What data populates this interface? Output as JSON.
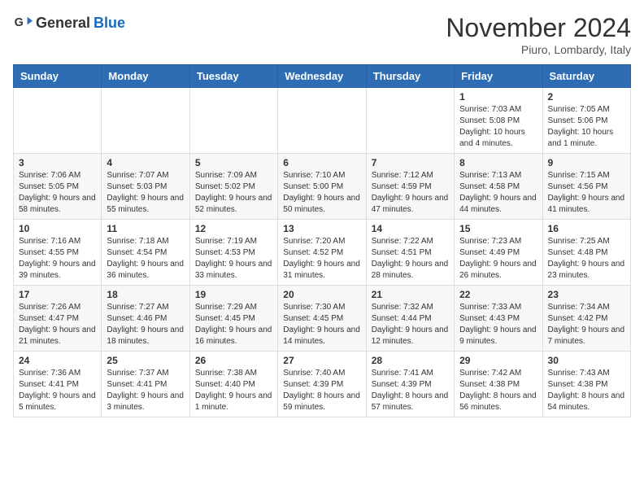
{
  "header": {
    "logo_general": "General",
    "logo_blue": "Blue",
    "month_title": "November 2024",
    "location": "Piuro, Lombardy, Italy"
  },
  "weekdays": [
    "Sunday",
    "Monday",
    "Tuesday",
    "Wednesday",
    "Thursday",
    "Friday",
    "Saturday"
  ],
  "weeks": [
    [
      {
        "day": "",
        "info": ""
      },
      {
        "day": "",
        "info": ""
      },
      {
        "day": "",
        "info": ""
      },
      {
        "day": "",
        "info": ""
      },
      {
        "day": "",
        "info": ""
      },
      {
        "day": "1",
        "info": "Sunrise: 7:03 AM\nSunset: 5:08 PM\nDaylight: 10 hours and 4 minutes."
      },
      {
        "day": "2",
        "info": "Sunrise: 7:05 AM\nSunset: 5:06 PM\nDaylight: 10 hours and 1 minute."
      }
    ],
    [
      {
        "day": "3",
        "info": "Sunrise: 7:06 AM\nSunset: 5:05 PM\nDaylight: 9 hours and 58 minutes."
      },
      {
        "day": "4",
        "info": "Sunrise: 7:07 AM\nSunset: 5:03 PM\nDaylight: 9 hours and 55 minutes."
      },
      {
        "day": "5",
        "info": "Sunrise: 7:09 AM\nSunset: 5:02 PM\nDaylight: 9 hours and 52 minutes."
      },
      {
        "day": "6",
        "info": "Sunrise: 7:10 AM\nSunset: 5:00 PM\nDaylight: 9 hours and 50 minutes."
      },
      {
        "day": "7",
        "info": "Sunrise: 7:12 AM\nSunset: 4:59 PM\nDaylight: 9 hours and 47 minutes."
      },
      {
        "day": "8",
        "info": "Sunrise: 7:13 AM\nSunset: 4:58 PM\nDaylight: 9 hours and 44 minutes."
      },
      {
        "day": "9",
        "info": "Sunrise: 7:15 AM\nSunset: 4:56 PM\nDaylight: 9 hours and 41 minutes."
      }
    ],
    [
      {
        "day": "10",
        "info": "Sunrise: 7:16 AM\nSunset: 4:55 PM\nDaylight: 9 hours and 39 minutes."
      },
      {
        "day": "11",
        "info": "Sunrise: 7:18 AM\nSunset: 4:54 PM\nDaylight: 9 hours and 36 minutes."
      },
      {
        "day": "12",
        "info": "Sunrise: 7:19 AM\nSunset: 4:53 PM\nDaylight: 9 hours and 33 minutes."
      },
      {
        "day": "13",
        "info": "Sunrise: 7:20 AM\nSunset: 4:52 PM\nDaylight: 9 hours and 31 minutes."
      },
      {
        "day": "14",
        "info": "Sunrise: 7:22 AM\nSunset: 4:51 PM\nDaylight: 9 hours and 28 minutes."
      },
      {
        "day": "15",
        "info": "Sunrise: 7:23 AM\nSunset: 4:49 PM\nDaylight: 9 hours and 26 minutes."
      },
      {
        "day": "16",
        "info": "Sunrise: 7:25 AM\nSunset: 4:48 PM\nDaylight: 9 hours and 23 minutes."
      }
    ],
    [
      {
        "day": "17",
        "info": "Sunrise: 7:26 AM\nSunset: 4:47 PM\nDaylight: 9 hours and 21 minutes."
      },
      {
        "day": "18",
        "info": "Sunrise: 7:27 AM\nSunset: 4:46 PM\nDaylight: 9 hours and 18 minutes."
      },
      {
        "day": "19",
        "info": "Sunrise: 7:29 AM\nSunset: 4:45 PM\nDaylight: 9 hours and 16 minutes."
      },
      {
        "day": "20",
        "info": "Sunrise: 7:30 AM\nSunset: 4:45 PM\nDaylight: 9 hours and 14 minutes."
      },
      {
        "day": "21",
        "info": "Sunrise: 7:32 AM\nSunset: 4:44 PM\nDaylight: 9 hours and 12 minutes."
      },
      {
        "day": "22",
        "info": "Sunrise: 7:33 AM\nSunset: 4:43 PM\nDaylight: 9 hours and 9 minutes."
      },
      {
        "day": "23",
        "info": "Sunrise: 7:34 AM\nSunset: 4:42 PM\nDaylight: 9 hours and 7 minutes."
      }
    ],
    [
      {
        "day": "24",
        "info": "Sunrise: 7:36 AM\nSunset: 4:41 PM\nDaylight: 9 hours and 5 minutes."
      },
      {
        "day": "25",
        "info": "Sunrise: 7:37 AM\nSunset: 4:41 PM\nDaylight: 9 hours and 3 minutes."
      },
      {
        "day": "26",
        "info": "Sunrise: 7:38 AM\nSunset: 4:40 PM\nDaylight: 9 hours and 1 minute."
      },
      {
        "day": "27",
        "info": "Sunrise: 7:40 AM\nSunset: 4:39 PM\nDaylight: 8 hours and 59 minutes."
      },
      {
        "day": "28",
        "info": "Sunrise: 7:41 AM\nSunset: 4:39 PM\nDaylight: 8 hours and 57 minutes."
      },
      {
        "day": "29",
        "info": "Sunrise: 7:42 AM\nSunset: 4:38 PM\nDaylight: 8 hours and 56 minutes."
      },
      {
        "day": "30",
        "info": "Sunrise: 7:43 AM\nSunset: 4:38 PM\nDaylight: 8 hours and 54 minutes."
      }
    ]
  ]
}
